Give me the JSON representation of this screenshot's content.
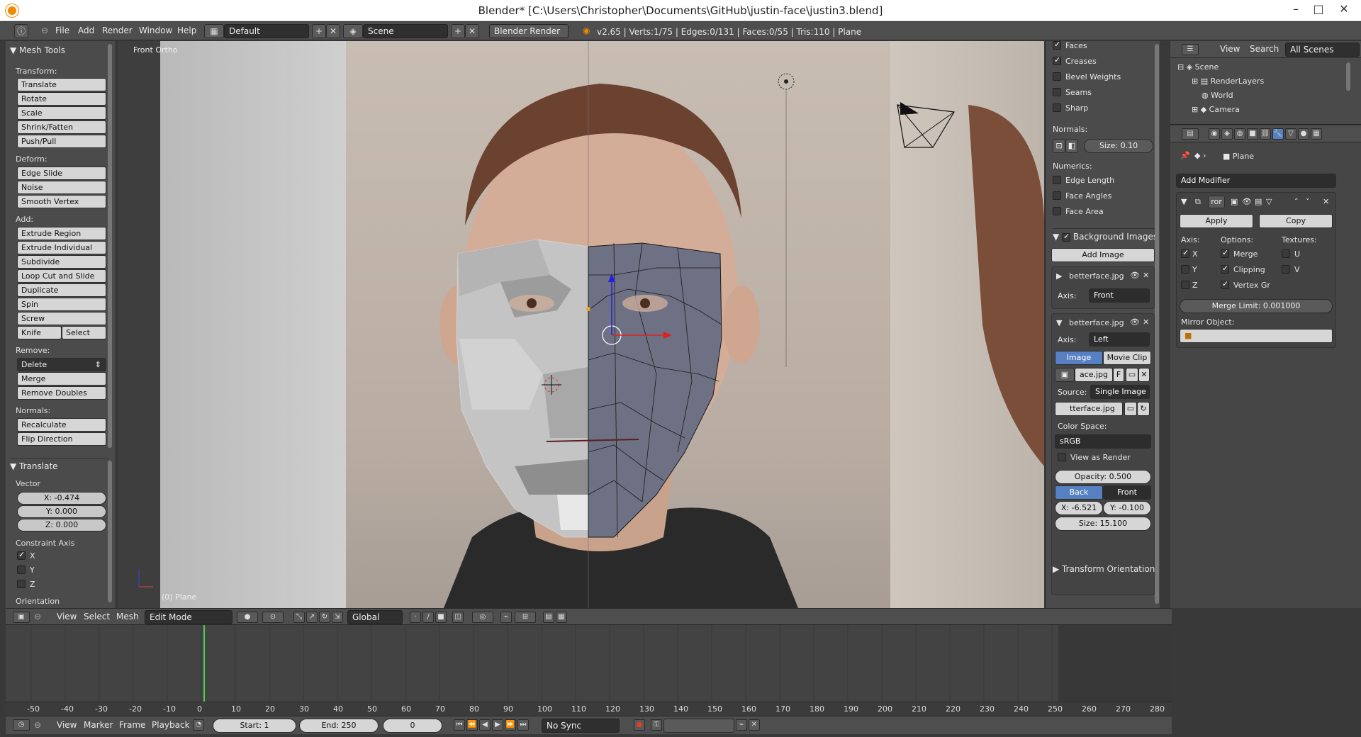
{
  "window": {
    "title": "Blender* [C:\\Users\\Christopher\\Documents\\GitHub\\justin-face\\justin3.blend]",
    "minimize": "–",
    "maximize": "□",
    "close": "✕"
  },
  "infobar": {
    "menus": [
      "File",
      "Add",
      "Render",
      "Window",
      "Help"
    ],
    "layout": "Default",
    "scene": "Scene",
    "engine": "Blender Render",
    "stats": "v2.65 | Verts:1/75 | Edges:0/131 | Faces:0/55 | Tris:110 | Plane"
  },
  "toolshelf": {
    "title": "Mesh Tools",
    "transform_label": "Transform:",
    "transform": [
      "Translate",
      "Rotate",
      "Scale",
      "Shrink/Fatten",
      "Push/Pull"
    ],
    "deform_label": "Deform:",
    "deform": [
      "Edge Slide",
      "Noise",
      "Smooth Vertex"
    ],
    "add_label": "Add:",
    "add": [
      "Extrude Region",
      "Extrude Individual",
      "Subdivide",
      "Loop Cut and Slide",
      "Duplicate",
      "Spin",
      "Screw"
    ],
    "knife": "Knife",
    "select": "Select",
    "remove_label": "Remove:",
    "delete": "Delete",
    "remove": [
      "Merge",
      "Remove Doubles"
    ],
    "normals_label": "Normals:",
    "normals": [
      "Recalculate",
      "Flip Direction"
    ],
    "operator_title": "Translate",
    "vector_label": "Vector",
    "vector": [
      "X: -0.474",
      "Y: 0.000",
      "Z: 0.000"
    ],
    "constraint_label": "Constraint Axis",
    "axes": [
      {
        "label": "X",
        "checked": true
      },
      {
        "label": "Y",
        "checked": false
      },
      {
        "label": "Z",
        "checked": false
      }
    ],
    "orientation_label": "Orientation"
  },
  "viewport": {
    "view_label": "Front Ortho",
    "object_label": "(0) Plane"
  },
  "npanel": {
    "overlays": [
      {
        "label": "Faces",
        "checked": true
      },
      {
        "label": "Creases",
        "checked": true
      },
      {
        "label": "Bevel Weights",
        "checked": false
      },
      {
        "label": "Seams",
        "checked": false
      },
      {
        "label": "Sharp",
        "checked": false
      }
    ],
    "normals_label": "Normals:",
    "normals_size": "Size: 0.10",
    "numerics_label": "Numerics:",
    "numerics": [
      {
        "label": "Edge Length",
        "checked": false
      },
      {
        "label": "Face Angles",
        "checked": false
      },
      {
        "label": "Face Area",
        "checked": false
      }
    ],
    "bg_images_title": "Background Images",
    "add_image": "Add Image",
    "img1": {
      "name": "betterface.jpg",
      "axis_label": "Axis:",
      "axis": "Front"
    },
    "img2": {
      "name": "betterface.jpg",
      "axis_label": "Axis:",
      "axis": "Left",
      "tab_image": "Image",
      "tab_movieclip": "Movie Clip",
      "file": "ace.jpg",
      "file_flag": "F",
      "source_label": "Source:",
      "source": "Single Image",
      "image_file": "tterface.jpg",
      "colorspace_label": "Color Space:",
      "colorspace": "sRGB",
      "view_as_render": "View as Render",
      "opacity": "Opacity: 0.500",
      "back": "Back",
      "front": "Front",
      "offset_x": "X: -6.521",
      "offset_y": "Y: -0.100",
      "size": "Size: 15.100"
    },
    "transform_orientations": "Transform Orientations"
  },
  "outliner": {
    "view": "View",
    "search": "Search",
    "filter": "All Scenes",
    "items": [
      "Scene",
      "RenderLayers",
      "World",
      "Camera"
    ]
  },
  "properties": {
    "object": "Plane",
    "add_modifier": "Add Modifier",
    "modifier_name": "ror",
    "apply": "Apply",
    "copy": "Copy",
    "axis_label": "Axis:",
    "options_label": "Options:",
    "textures_label": "Textures:",
    "axis": [
      {
        "label": "X",
        "checked": true
      },
      {
        "label": "Y",
        "checked": false
      },
      {
        "label": "Z",
        "checked": false
      }
    ],
    "options": [
      {
        "label": "Merge",
        "checked": true
      },
      {
        "label": "Clipping",
        "checked": true
      },
      {
        "label": "Vertex Gr",
        "checked": true
      }
    ],
    "textures": [
      {
        "label": "U",
        "checked": false
      },
      {
        "label": "V",
        "checked": false
      }
    ],
    "merge_limit": "Merge Limit: 0.001000",
    "mirror_object": "Mirror Object:"
  },
  "viewheader": {
    "menus": [
      "View",
      "Select",
      "Mesh"
    ],
    "mode": "Edit Mode",
    "orientation": "Global"
  },
  "timeline": {
    "ticks": [
      "-50",
      "-40",
      "-30",
      "-20",
      "-10",
      "0",
      "10",
      "20",
      "30",
      "40",
      "50",
      "60",
      "70",
      "80",
      "90",
      "100",
      "110",
      "120",
      "130",
      "140",
      "150",
      "160",
      "170",
      "180",
      "190",
      "200",
      "210",
      "220",
      "230",
      "240",
      "250",
      "260",
      "270",
      "280"
    ],
    "menus": [
      "View",
      "Marker",
      "Frame",
      "Playback"
    ],
    "start": "Start: 1",
    "end": "End: 250",
    "current": "0",
    "sync": "No Sync"
  },
  "colors": {
    "accent_blue": "#5680c2",
    "frame_marker": "#4cd04c",
    "mesh_dark": "#6e7083",
    "mesh_light": "#c8c8c8"
  }
}
